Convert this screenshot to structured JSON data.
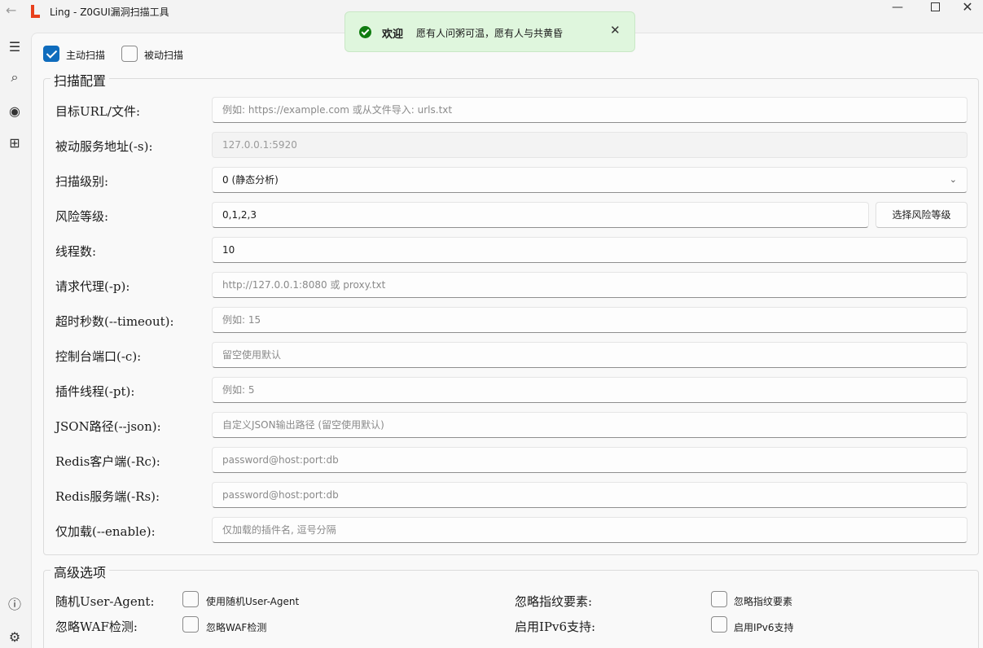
{
  "window": {
    "title": "Ling - Z0GUI漏洞扫描工具",
    "controls": {
      "minimize": "—",
      "close": "✕"
    }
  },
  "nav": {
    "back": "←",
    "menu": "☰",
    "search": "⌕",
    "eye": "◉",
    "plugins": "⊞",
    "info": "ⓘ",
    "settings": "⚙"
  },
  "toast": {
    "title": "欢迎",
    "message": "愿有人问粥可温，愿有人与共黄昏",
    "close": "✕"
  },
  "modes": {
    "active": {
      "label": "主动扫描",
      "checked": true
    },
    "passive": {
      "label": "被动扫描",
      "checked": false
    }
  },
  "config": {
    "title": "扫描配置",
    "fields": [
      {
        "label": "目标URL/文件:",
        "value": "",
        "placeholder": "例如: https://example.com 或从文件导入: urls.txt"
      },
      {
        "label": "被动服务地址(-s):",
        "value": "",
        "placeholder": "127.0.0.1:5920"
      },
      {
        "label": "扫描级别:",
        "value": "0 (静态分析)",
        "placeholder": ""
      },
      {
        "label": "风险等级:",
        "value": "0,1,2,3",
        "placeholder": ""
      },
      {
        "label": "线程数:",
        "value": "10",
        "placeholder": ""
      },
      {
        "label": "请求代理(-p):",
        "value": "",
        "placeholder": "http://127.0.0.1:8080 或 proxy.txt"
      },
      {
        "label": "超时秒数(--timeout):",
        "value": "",
        "placeholder": "例如: 15"
      },
      {
        "label": "控制台端口(-c):",
        "value": "",
        "placeholder": "留空使用默认"
      },
      {
        "label": "插件线程(-pt):",
        "value": "",
        "placeholder": "例如: 5"
      },
      {
        "label": "JSON路径(--json):",
        "value": "",
        "placeholder": "自定义JSON输出路径 (留空使用默认)"
      },
      {
        "label": "Redis客户端(-Rc):",
        "value": "",
        "placeholder": "password@host:port:db"
      },
      {
        "label": "Redis服务端(-Rs):",
        "value": "",
        "placeholder": "password@host:port:db"
      },
      {
        "label": "仅加载(--enable):",
        "value": "",
        "placeholder": "仅加载的插件名, 逗号分隔"
      }
    ],
    "risk_button": "选择风险等级",
    "dropdown_chevron": "⌄"
  },
  "advanced": {
    "title": "高级选项",
    "rows": [
      {
        "left_label": "随机User-Agent:",
        "left_option": "使用随机User-Agent",
        "right_label": "忽略指纹要素:",
        "right_option": "忽略指纹要素"
      },
      {
        "left_label": "忽略WAF检测:",
        "left_option": "忽略WAF检测",
        "right_label": "启用IPv6支持:",
        "right_option": "启用IPv6支持"
      }
    ]
  },
  "colors": {
    "accent": "#0f6cbd",
    "logo": "#e8401c",
    "toast_bg": "#dff6dd",
    "toast_icon": "#107c10"
  }
}
